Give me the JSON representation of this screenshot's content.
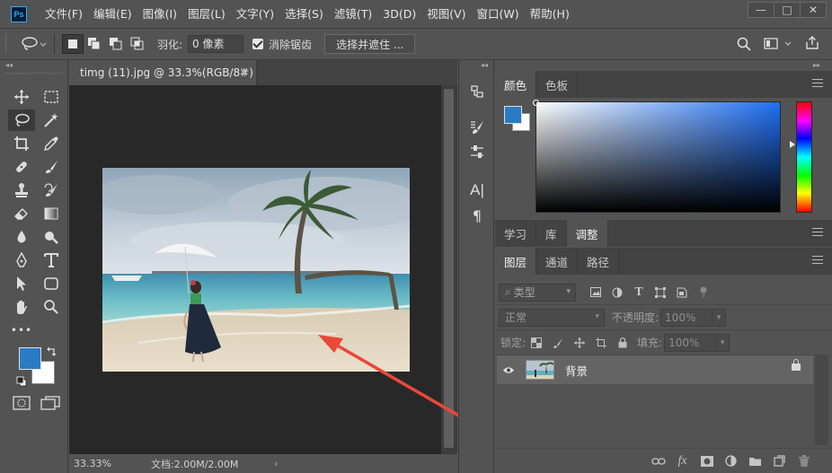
{
  "app": {
    "logo": "Ps"
  },
  "menu": [
    "文件(F)",
    "编辑(E)",
    "图像(I)",
    "图层(L)",
    "文字(Y)",
    "选择(S)",
    "滤镜(T)",
    "3D(D)",
    "视图(V)",
    "窗口(W)",
    "帮助(H)"
  ],
  "window_controls": {
    "minimize": "—",
    "maximize": "□",
    "close": "✕"
  },
  "options": {
    "feather_label": "羽化:",
    "feather_value": "0 像素",
    "antialias_label": "消除锯齿",
    "antialias_checked": true,
    "select_mask_label": "选择并遮住 ..."
  },
  "toolbar": {
    "collapse_arrows": "◂◂",
    "more": "•••"
  },
  "document": {
    "tab_title": "timg (11).jpg @ 33.3%(RGB/8#)",
    "close_glyph": "×",
    "zoom": "33.33%",
    "doc_size": "文档:2.00M/2.00M",
    "status_arrow": "›"
  },
  "colors": {
    "foreground": "#2a7bc4",
    "background": "#ffffff",
    "arrow": "#e8483a"
  },
  "color_panel": {
    "tabs": [
      "颜色",
      "色板"
    ],
    "active": 0
  },
  "adjust_panel": {
    "tabs": [
      "学习",
      "库",
      "调整"
    ],
    "active": 2
  },
  "layers_panel": {
    "tabs": [
      "图层",
      "通道",
      "路径"
    ],
    "active": 0,
    "filter_placeholder": "类型",
    "blend_mode": "正常",
    "opacity_label": "不透明度:",
    "opacity_value": "100%",
    "lock_label": "锁定:",
    "fill_label": "填充:",
    "fill_value": "100%",
    "layers": [
      {
        "name": "背景",
        "visible": true,
        "locked": true
      }
    ]
  },
  "icons": {
    "footer": [
      "link-icon",
      "fx-icon",
      "mask-icon",
      "adjustment-icon",
      "group-folder-icon",
      "new-layer-icon",
      "trash-icon"
    ]
  }
}
